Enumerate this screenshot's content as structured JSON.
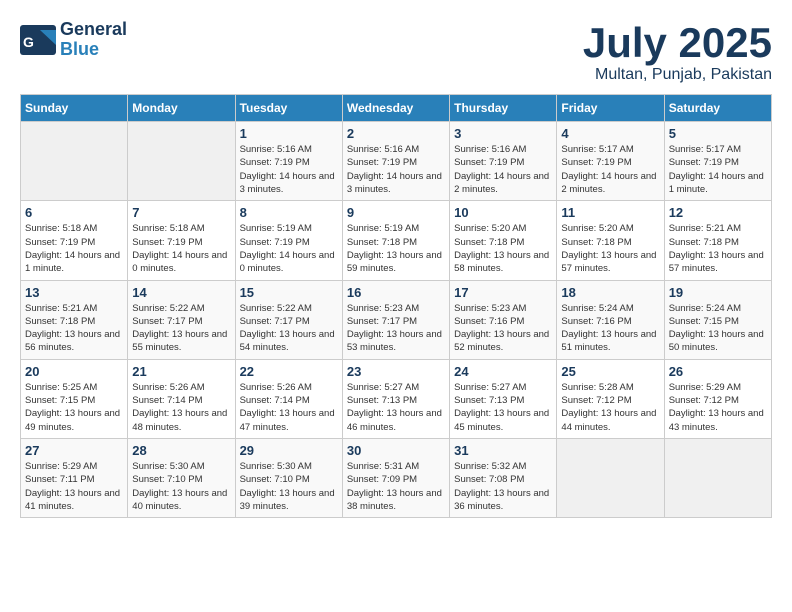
{
  "header": {
    "logo_general": "General",
    "logo_blue": "Blue",
    "month_title": "July 2025",
    "location": "Multan, Punjab, Pakistan"
  },
  "weekdays": [
    "Sunday",
    "Monday",
    "Tuesday",
    "Wednesday",
    "Thursday",
    "Friday",
    "Saturday"
  ],
  "weeks": [
    [
      {
        "day": "",
        "detail": ""
      },
      {
        "day": "",
        "detail": ""
      },
      {
        "day": "1",
        "detail": "Sunrise: 5:16 AM\nSunset: 7:19 PM\nDaylight: 14 hours and 3 minutes."
      },
      {
        "day": "2",
        "detail": "Sunrise: 5:16 AM\nSunset: 7:19 PM\nDaylight: 14 hours and 3 minutes."
      },
      {
        "day": "3",
        "detail": "Sunrise: 5:16 AM\nSunset: 7:19 PM\nDaylight: 14 hours and 2 minutes."
      },
      {
        "day": "4",
        "detail": "Sunrise: 5:17 AM\nSunset: 7:19 PM\nDaylight: 14 hours and 2 minutes."
      },
      {
        "day": "5",
        "detail": "Sunrise: 5:17 AM\nSunset: 7:19 PM\nDaylight: 14 hours and 1 minute."
      }
    ],
    [
      {
        "day": "6",
        "detail": "Sunrise: 5:18 AM\nSunset: 7:19 PM\nDaylight: 14 hours and 1 minute."
      },
      {
        "day": "7",
        "detail": "Sunrise: 5:18 AM\nSunset: 7:19 PM\nDaylight: 14 hours and 0 minutes."
      },
      {
        "day": "8",
        "detail": "Sunrise: 5:19 AM\nSunset: 7:19 PM\nDaylight: 14 hours and 0 minutes."
      },
      {
        "day": "9",
        "detail": "Sunrise: 5:19 AM\nSunset: 7:18 PM\nDaylight: 13 hours and 59 minutes."
      },
      {
        "day": "10",
        "detail": "Sunrise: 5:20 AM\nSunset: 7:18 PM\nDaylight: 13 hours and 58 minutes."
      },
      {
        "day": "11",
        "detail": "Sunrise: 5:20 AM\nSunset: 7:18 PM\nDaylight: 13 hours and 57 minutes."
      },
      {
        "day": "12",
        "detail": "Sunrise: 5:21 AM\nSunset: 7:18 PM\nDaylight: 13 hours and 57 minutes."
      }
    ],
    [
      {
        "day": "13",
        "detail": "Sunrise: 5:21 AM\nSunset: 7:18 PM\nDaylight: 13 hours and 56 minutes."
      },
      {
        "day": "14",
        "detail": "Sunrise: 5:22 AM\nSunset: 7:17 PM\nDaylight: 13 hours and 55 minutes."
      },
      {
        "day": "15",
        "detail": "Sunrise: 5:22 AM\nSunset: 7:17 PM\nDaylight: 13 hours and 54 minutes."
      },
      {
        "day": "16",
        "detail": "Sunrise: 5:23 AM\nSunset: 7:17 PM\nDaylight: 13 hours and 53 minutes."
      },
      {
        "day": "17",
        "detail": "Sunrise: 5:23 AM\nSunset: 7:16 PM\nDaylight: 13 hours and 52 minutes."
      },
      {
        "day": "18",
        "detail": "Sunrise: 5:24 AM\nSunset: 7:16 PM\nDaylight: 13 hours and 51 minutes."
      },
      {
        "day": "19",
        "detail": "Sunrise: 5:24 AM\nSunset: 7:15 PM\nDaylight: 13 hours and 50 minutes."
      }
    ],
    [
      {
        "day": "20",
        "detail": "Sunrise: 5:25 AM\nSunset: 7:15 PM\nDaylight: 13 hours and 49 minutes."
      },
      {
        "day": "21",
        "detail": "Sunrise: 5:26 AM\nSunset: 7:14 PM\nDaylight: 13 hours and 48 minutes."
      },
      {
        "day": "22",
        "detail": "Sunrise: 5:26 AM\nSunset: 7:14 PM\nDaylight: 13 hours and 47 minutes."
      },
      {
        "day": "23",
        "detail": "Sunrise: 5:27 AM\nSunset: 7:13 PM\nDaylight: 13 hours and 46 minutes."
      },
      {
        "day": "24",
        "detail": "Sunrise: 5:27 AM\nSunset: 7:13 PM\nDaylight: 13 hours and 45 minutes."
      },
      {
        "day": "25",
        "detail": "Sunrise: 5:28 AM\nSunset: 7:12 PM\nDaylight: 13 hours and 44 minutes."
      },
      {
        "day": "26",
        "detail": "Sunrise: 5:29 AM\nSunset: 7:12 PM\nDaylight: 13 hours and 43 minutes."
      }
    ],
    [
      {
        "day": "27",
        "detail": "Sunrise: 5:29 AM\nSunset: 7:11 PM\nDaylight: 13 hours and 41 minutes."
      },
      {
        "day": "28",
        "detail": "Sunrise: 5:30 AM\nSunset: 7:10 PM\nDaylight: 13 hours and 40 minutes."
      },
      {
        "day": "29",
        "detail": "Sunrise: 5:30 AM\nSunset: 7:10 PM\nDaylight: 13 hours and 39 minutes."
      },
      {
        "day": "30",
        "detail": "Sunrise: 5:31 AM\nSunset: 7:09 PM\nDaylight: 13 hours and 38 minutes."
      },
      {
        "day": "31",
        "detail": "Sunrise: 5:32 AM\nSunset: 7:08 PM\nDaylight: 13 hours and 36 minutes."
      },
      {
        "day": "",
        "detail": ""
      },
      {
        "day": "",
        "detail": ""
      }
    ]
  ]
}
